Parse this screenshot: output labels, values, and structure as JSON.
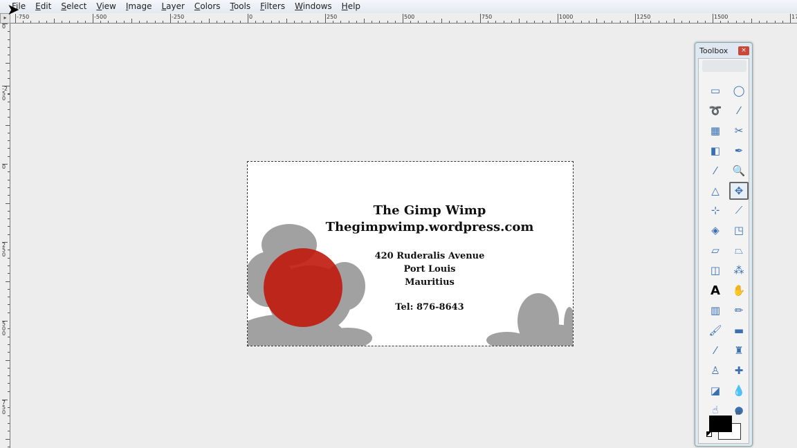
{
  "menubar": [
    "File",
    "Edit",
    "Select",
    "View",
    "Image",
    "Layer",
    "Colors",
    "Tools",
    "Filters",
    "Windows",
    "Help"
  ],
  "hruler_labels": [
    "-750",
    "-500",
    "-250",
    "0",
    "250",
    "500",
    "750",
    "1000",
    "1250",
    "1500",
    "17"
  ],
  "vruler_labels": [
    "0",
    "-250",
    "0",
    "250",
    "500",
    "750"
  ],
  "card": {
    "title": "The Gimp Wimp",
    "website": "Thegimpwimp.wordpress.com",
    "address1": "420 Ruderalis Avenue",
    "address2": "Port Louis",
    "address3": "Mauritius",
    "phone": "Tel:  876-8643",
    "circle_color": "#c01a0c"
  },
  "toolbox": {
    "title": "Toolbox",
    "close": "×",
    "active_tool": "move",
    "tools": [
      {
        "name": "rect-select",
        "glyph": "▭"
      },
      {
        "name": "ellipse-select",
        "glyph": "◯"
      },
      {
        "name": "free-select",
        "glyph": "➰"
      },
      {
        "name": "fuzzy-select",
        "glyph": "⁄"
      },
      {
        "name": "select-by-color",
        "glyph": "▦"
      },
      {
        "name": "scissors-select",
        "glyph": "✂"
      },
      {
        "name": "foreground-select",
        "glyph": "◧"
      },
      {
        "name": "paths",
        "glyph": "✒"
      },
      {
        "name": "color-picker",
        "glyph": "⁄"
      },
      {
        "name": "zoom",
        "glyph": "🔍"
      },
      {
        "name": "measure",
        "glyph": "△"
      },
      {
        "name": "move",
        "glyph": "✥"
      },
      {
        "name": "align",
        "glyph": "⊹"
      },
      {
        "name": "crop",
        "glyph": "⟋"
      },
      {
        "name": "rotate",
        "glyph": "◈"
      },
      {
        "name": "scale",
        "glyph": "◳"
      },
      {
        "name": "shear",
        "glyph": "▱"
      },
      {
        "name": "perspective",
        "glyph": "⏢"
      },
      {
        "name": "flip",
        "glyph": "◫"
      },
      {
        "name": "cage-transform",
        "glyph": "⁂"
      },
      {
        "name": "text",
        "glyph": "A"
      },
      {
        "name": "bucket-fill",
        "glyph": "✋"
      },
      {
        "name": "blend",
        "glyph": "▥"
      },
      {
        "name": "pencil",
        "glyph": "✏"
      },
      {
        "name": "paintbrush",
        "glyph": "🖌"
      },
      {
        "name": "eraser",
        "glyph": "▬"
      },
      {
        "name": "airbrush",
        "glyph": "⁄"
      },
      {
        "name": "ink",
        "glyph": "♜"
      },
      {
        "name": "clone",
        "glyph": "♙"
      },
      {
        "name": "heal",
        "glyph": "✚"
      },
      {
        "name": "perspective-clone",
        "glyph": "◪"
      },
      {
        "name": "blur-sharpen",
        "glyph": "💧"
      },
      {
        "name": "smudge",
        "glyph": "☝"
      },
      {
        "name": "dodge-burn",
        "glyph": "●"
      }
    ],
    "fg_color": "#000000",
    "bg_color": "#ffffff"
  }
}
